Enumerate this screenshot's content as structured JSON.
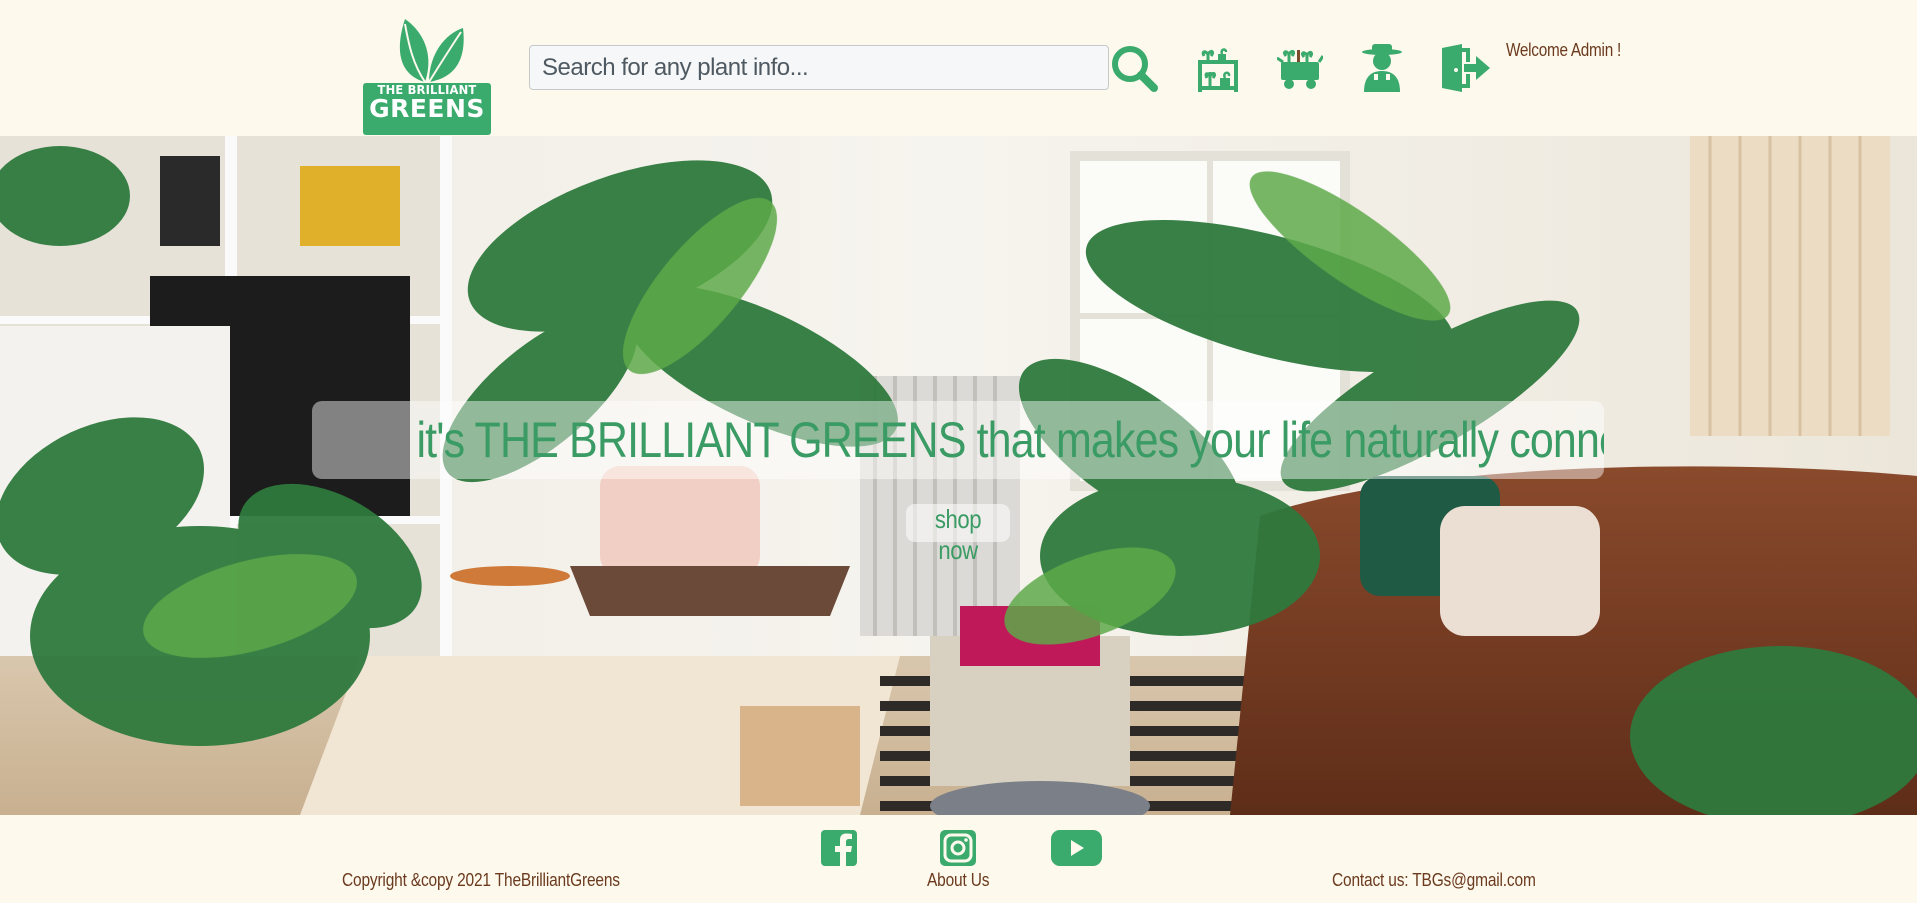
{
  "header": {
    "logo": {
      "line1": "THE BRILLIANT",
      "line2": "GREENS"
    },
    "search": {
      "placeholder": "Search for any plant info...",
      "value": ""
    },
    "icons": [
      "search-icon",
      "plant-shelf-icon",
      "garden-cart-icon",
      "gardener-icon",
      "logout-icon"
    ],
    "welcome": "Welcome Admin !"
  },
  "hero": {
    "tagline": "it's THE BRILLIANT GREENS that makes your life naturally connected",
    "cta": "shop now"
  },
  "footer": {
    "copyright": "Copyright &copy 2021 TheBrilliantGreens",
    "about": "About Us",
    "contact": "Contact us: TBGs@gmail.com",
    "social": [
      "facebook-icon",
      "instagram-icon",
      "youtube-icon"
    ]
  },
  "colors": {
    "background": "#fdf9ec",
    "brand_green": "#3aaa6d",
    "text_brown": "#6b3a1f"
  }
}
